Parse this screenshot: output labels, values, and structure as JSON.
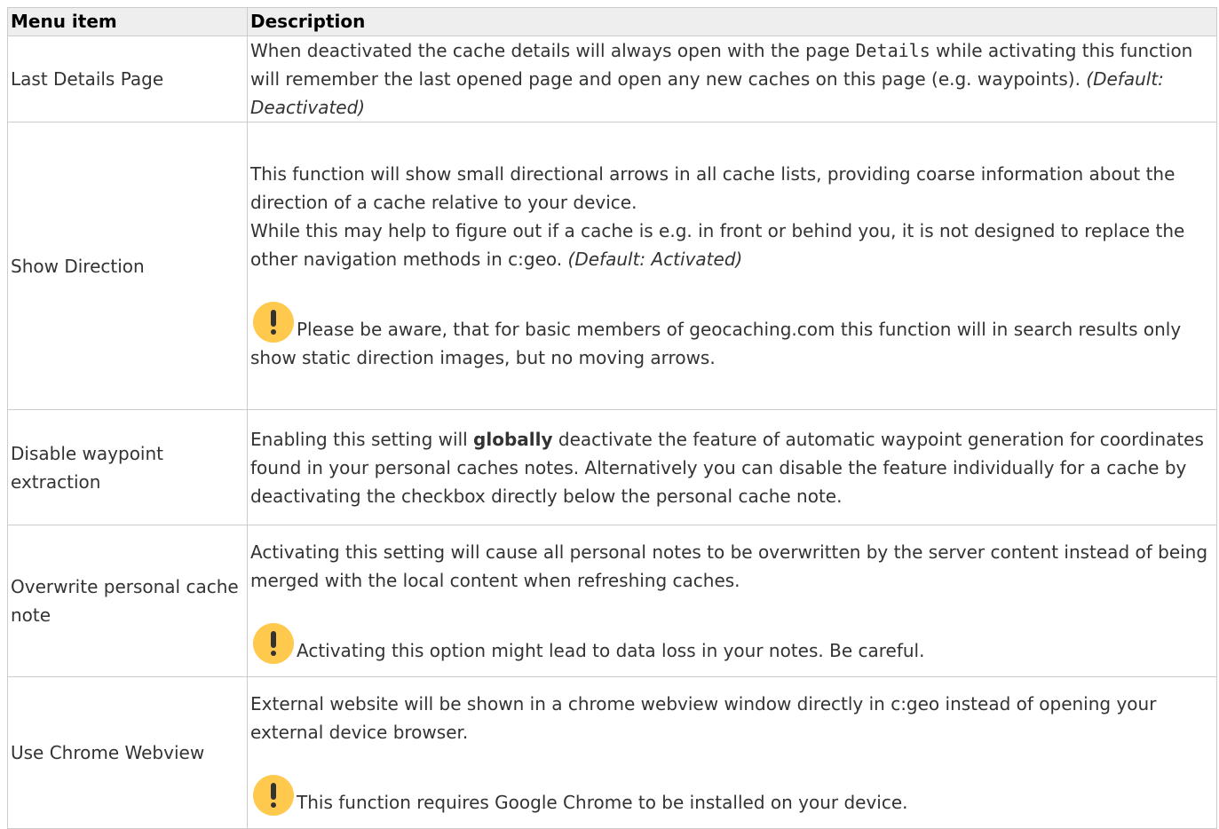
{
  "table": {
    "headers": {
      "item": "Menu item",
      "description": "Description"
    },
    "rows": [
      {
        "item": "Last Details Page",
        "p1_before": "When deactivated the cache details will always open with the page ",
        "p1_code": "Details",
        "p1_after": " while activating this function will remember the last opened page and open any new caches on this page (e.g. waypoints). ",
        "p1_default": "(Default: Deactivated)"
      },
      {
        "item": "Show Direction",
        "p1": "This function will show small directional arrows in all cache lists, providing coarse information about the direction of a cache relative to your device.",
        "p2": "While this may help to figure out if a cache is e.g. in front or behind you, it is not designed to replace the other navigation methods in c:geo. ",
        "p2_default": "(Default: Activated)",
        "warning": "Please be aware, that for basic members of geocaching.com this function will in search results only show static direction images, but no moving arrows."
      },
      {
        "item": "Disable waypoint extraction",
        "p1_before": "Enabling this setting will ",
        "p1_bold": "globally",
        "p1_after": " deactivate the feature of automatic waypoint generation for coordinates found in your personal caches notes. Alternatively you can disable the feature individually for a cache by deactivating the checkbox directly below the personal cache note."
      },
      {
        "item": "Overwrite personal cache note",
        "p1": "Activating this setting will cause all personal notes to be overwritten by the server content instead of being merged with the local content when refreshing caches.",
        "warning": "Activating this option might lead to data loss in your notes. Be careful."
      },
      {
        "item": "Use Chrome Webview",
        "p1": "External website will be shown in a chrome webview window directly in c:geo instead of opening your external device browser.",
        "warning": "This function requires Google Chrome to be installed on your device."
      }
    ]
  },
  "icons": {
    "warning": "exclamation-warning-icon",
    "warning_color": "#ffc94d"
  }
}
